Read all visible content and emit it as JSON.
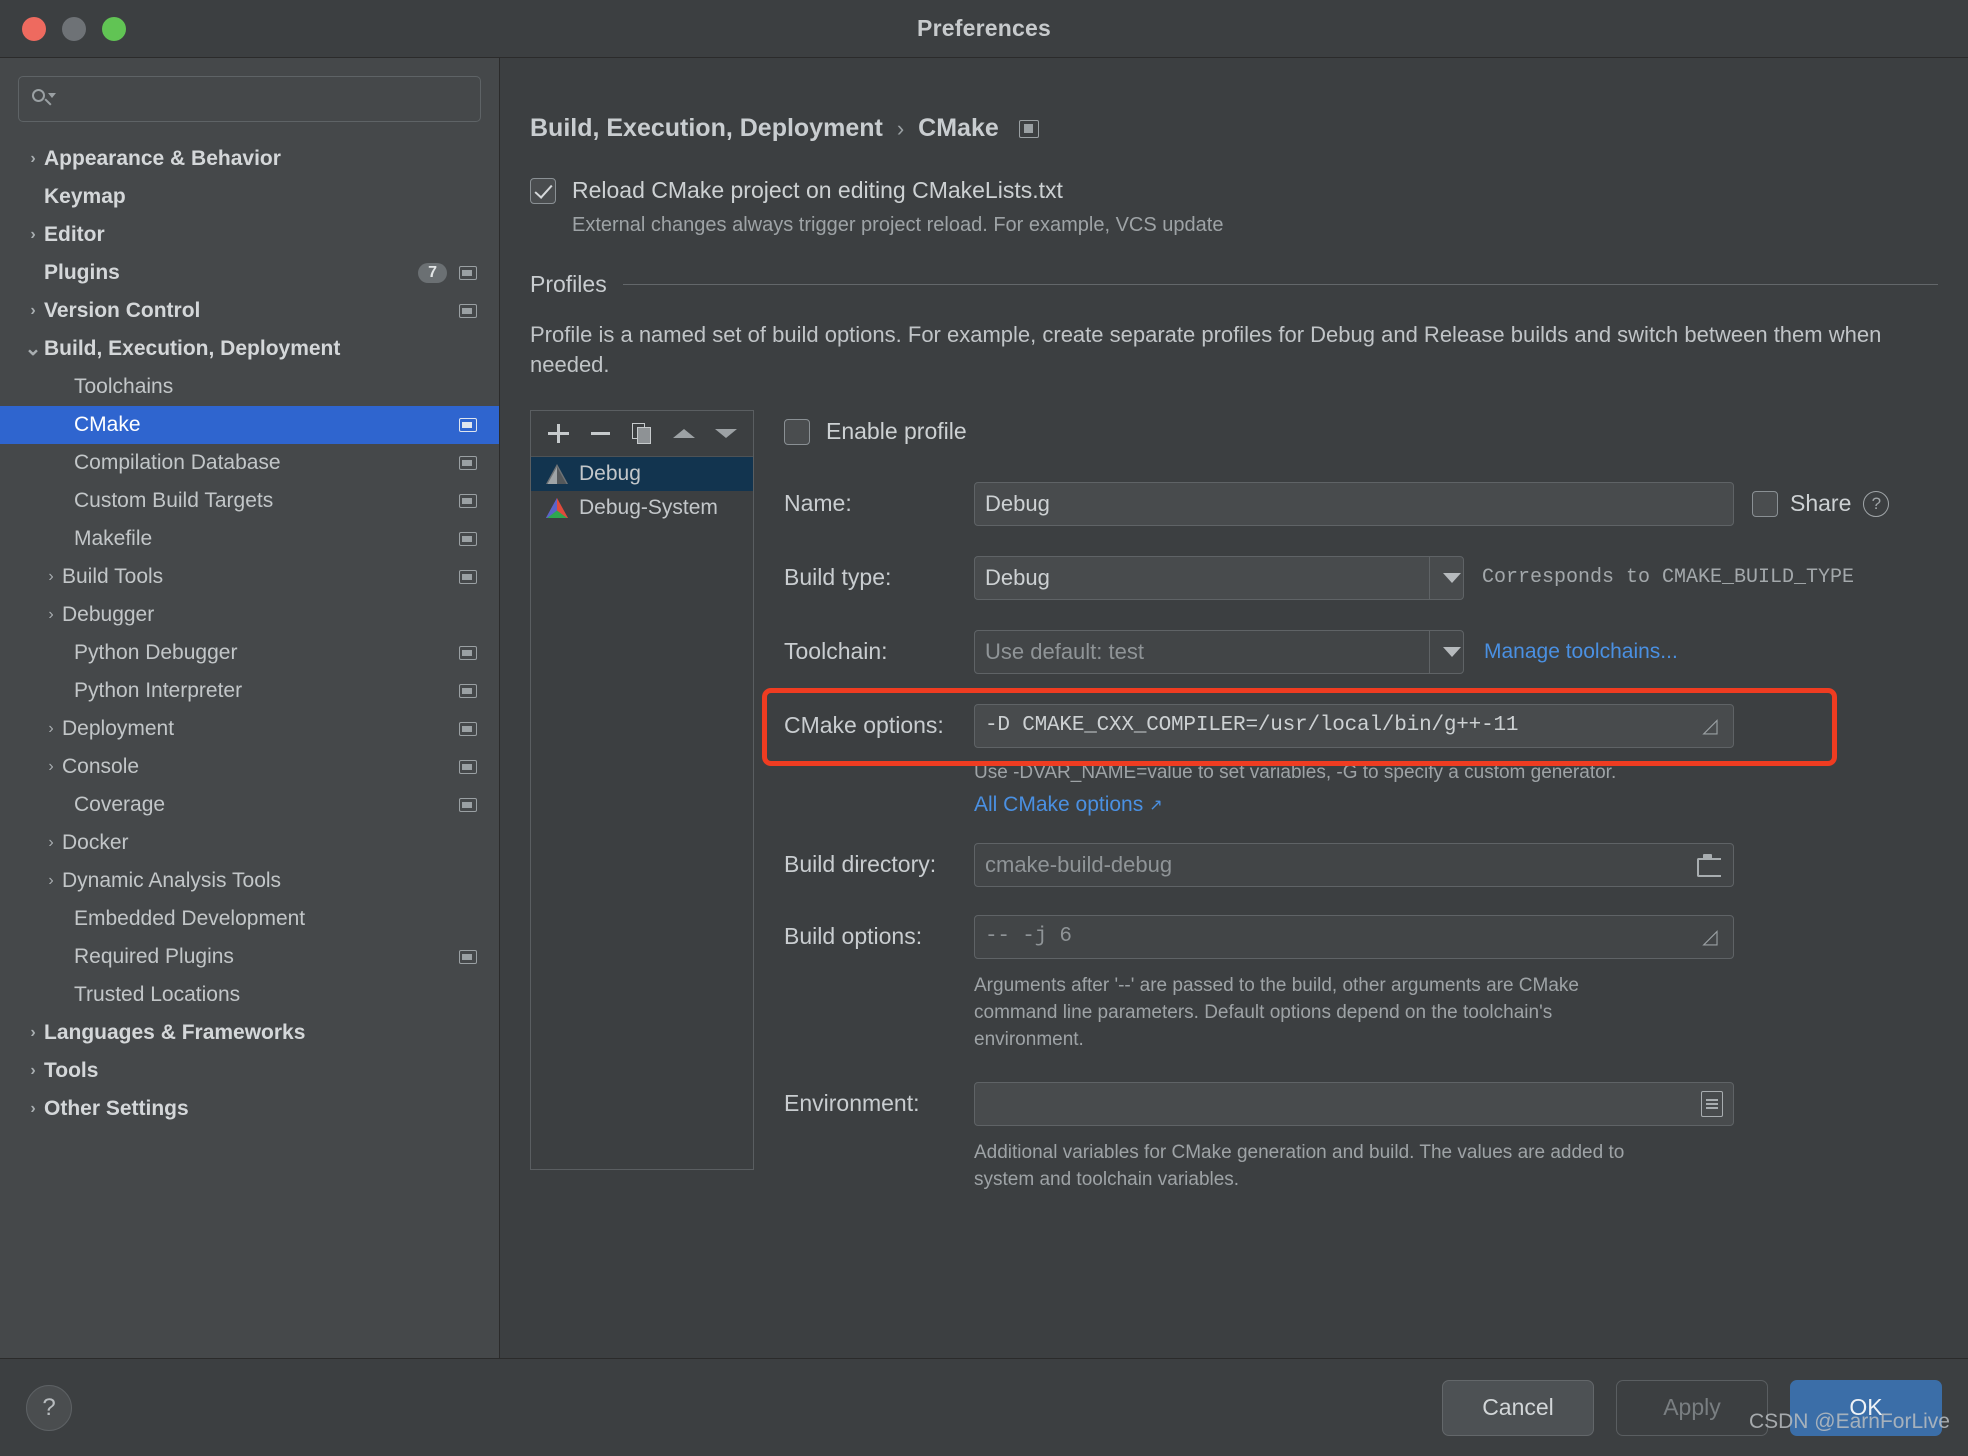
{
  "window": {
    "title": "Preferences",
    "traffic_lights": [
      "close-button",
      "minimize-button",
      "maximize-button"
    ]
  },
  "sidebar": {
    "search": {
      "value": "",
      "placeholder": ""
    },
    "items": [
      {
        "label": "Appearance & Behavior",
        "arrow": "›",
        "bold": true,
        "indent": 0,
        "badge": null,
        "mini": false,
        "selected": false
      },
      {
        "label": "Keymap",
        "arrow": "",
        "bold": true,
        "indent": 0,
        "badge": null,
        "mini": false,
        "selected": false
      },
      {
        "label": "Editor",
        "arrow": "›",
        "bold": true,
        "indent": 0,
        "badge": null,
        "mini": false,
        "selected": false
      },
      {
        "label": "Plugins",
        "arrow": "",
        "bold": true,
        "indent": 0,
        "badge": "7",
        "mini": true,
        "selected": false
      },
      {
        "label": "Version Control",
        "arrow": "›",
        "bold": true,
        "indent": 0,
        "badge": null,
        "mini": true,
        "selected": false
      },
      {
        "label": "Build, Execution, Deployment",
        "arrow": "⌄",
        "bold": true,
        "indent": 0,
        "badge": null,
        "mini": false,
        "selected": false
      },
      {
        "label": "Toolchains",
        "arrow": "",
        "bold": false,
        "indent": 1,
        "badge": null,
        "mini": false,
        "selected": false
      },
      {
        "label": "CMake",
        "arrow": "",
        "bold": false,
        "indent": 1,
        "badge": null,
        "mini": true,
        "selected": true
      },
      {
        "label": "Compilation Database",
        "arrow": "",
        "bold": false,
        "indent": 1,
        "badge": null,
        "mini": true,
        "selected": false
      },
      {
        "label": "Custom Build Targets",
        "arrow": "",
        "bold": false,
        "indent": 1,
        "badge": null,
        "mini": true,
        "selected": false
      },
      {
        "label": "Makefile",
        "arrow": "",
        "bold": false,
        "indent": 1,
        "badge": null,
        "mini": true,
        "selected": false
      },
      {
        "label": "Build Tools",
        "arrow": "›",
        "bold": false,
        "indent": 2,
        "badge": null,
        "mini": true,
        "selected": false
      },
      {
        "label": "Debugger",
        "arrow": "›",
        "bold": false,
        "indent": 2,
        "badge": null,
        "mini": false,
        "selected": false
      },
      {
        "label": "Python Debugger",
        "arrow": "",
        "bold": false,
        "indent": 1,
        "badge": null,
        "mini": true,
        "selected": false
      },
      {
        "label": "Python Interpreter",
        "arrow": "",
        "bold": false,
        "indent": 1,
        "badge": null,
        "mini": true,
        "selected": false
      },
      {
        "label": "Deployment",
        "arrow": "›",
        "bold": false,
        "indent": 2,
        "badge": null,
        "mini": true,
        "selected": false
      },
      {
        "label": "Console",
        "arrow": "›",
        "bold": false,
        "indent": 2,
        "badge": null,
        "mini": true,
        "selected": false
      },
      {
        "label": "Coverage",
        "arrow": "",
        "bold": false,
        "indent": 1,
        "badge": null,
        "mini": true,
        "selected": false
      },
      {
        "label": "Docker",
        "arrow": "›",
        "bold": false,
        "indent": 2,
        "badge": null,
        "mini": false,
        "selected": false
      },
      {
        "label": "Dynamic Analysis Tools",
        "arrow": "›",
        "bold": false,
        "indent": 2,
        "badge": null,
        "mini": false,
        "selected": false
      },
      {
        "label": "Embedded Development",
        "arrow": "",
        "bold": false,
        "indent": 1,
        "badge": null,
        "mini": false,
        "selected": false
      },
      {
        "label": "Required Plugins",
        "arrow": "",
        "bold": false,
        "indent": 1,
        "badge": null,
        "mini": true,
        "selected": false
      },
      {
        "label": "Trusted Locations",
        "arrow": "",
        "bold": false,
        "indent": 1,
        "badge": null,
        "mini": false,
        "selected": false
      },
      {
        "label": "Languages & Frameworks",
        "arrow": "›",
        "bold": true,
        "indent": 0,
        "badge": null,
        "mini": false,
        "selected": false
      },
      {
        "label": "Tools",
        "arrow": "›",
        "bold": true,
        "indent": 0,
        "badge": null,
        "mini": false,
        "selected": false
      },
      {
        "label": "Other Settings",
        "arrow": "›",
        "bold": true,
        "indent": 0,
        "badge": null,
        "mini": false,
        "selected": false
      }
    ]
  },
  "main": {
    "breadcrumb": {
      "root": "Build, Execution, Deployment",
      "separator": "›",
      "leaf": "CMake"
    },
    "reload": {
      "label": "Reload CMake project on editing CMakeLists.txt",
      "checked": true,
      "note": "External changes always trigger project reload. For example, VCS update"
    },
    "profiles_section": {
      "title": "Profiles",
      "description": "Profile is a named set of build options. For example, create separate profiles for Debug and Release builds and switch between them when needed."
    },
    "profile_toolbar": [
      "add-profile",
      "remove-profile",
      "copy-profile",
      "move-up",
      "move-down"
    ],
    "profile_list": [
      {
        "name": "Debug",
        "icon": "cmake-icon-gray",
        "selected": true
      },
      {
        "name": "Debug-System",
        "icon": "cmake-icon-color",
        "selected": false
      }
    ],
    "enable_profile": {
      "label": "Enable profile",
      "checked": false
    },
    "fields": {
      "name": {
        "label": "Name:",
        "value": "Debug"
      },
      "share": {
        "label": "Share",
        "checked": false,
        "help": "?"
      },
      "build_type": {
        "label": "Build type:",
        "value": "Debug",
        "note": "Corresponds to CMAKE_BUILD_TYPE"
      },
      "toolchain": {
        "label": "Toolchain:",
        "value": "Use default: test",
        "link": "Manage toolchains..."
      },
      "cmake_options": {
        "label": "CMake options:",
        "value": "-D CMAKE_CXX_COMPILER=/usr/local/bin/g++-11",
        "hint": "Use -DVAR_NAME=value to set variables, -G to specify a custom generator.",
        "link": "All CMake options",
        "link_arrow": "↗"
      },
      "build_directory": {
        "label": "Build directory:",
        "value": "cmake-build-debug"
      },
      "build_options": {
        "label": "Build options:",
        "value": "-- -j 6",
        "hint": "Arguments after '--' are passed to the build, other arguments are CMake command line parameters. Default options depend on the toolchain's environment."
      },
      "environment": {
        "label": "Environment:",
        "value": "",
        "hint": "Additional variables for CMake generation and build. The values are added to system and toolchain variables."
      }
    }
  },
  "footer": {
    "help": "?",
    "cancel": "Cancel",
    "apply": "Apply",
    "ok": "OK"
  },
  "watermark": "CSDN @EarnForLive",
  "colors": {
    "accent": "#2f65cf",
    "ok_button": "#3b6ea8",
    "link": "#4a90e2",
    "highlight_box": "#ef3c21",
    "window_bg": "#3c3f41",
    "sidebar_bg": "#45484a"
  }
}
